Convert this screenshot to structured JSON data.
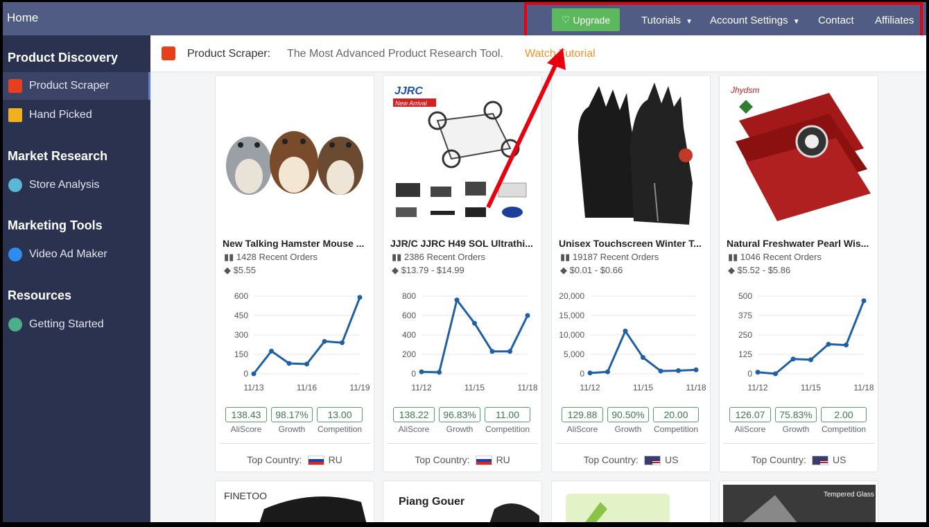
{
  "topbar": {
    "home": "Home",
    "upgrade": "Upgrade",
    "tutorials": "Tutorials",
    "account": "Account Settings",
    "contact": "Contact",
    "affiliates": "Affiliates"
  },
  "sidebar": {
    "sections": [
      {
        "title": "Product Discovery",
        "items": [
          {
            "label": "Product Scraper",
            "icon": "aliexpress-icon",
            "active": true
          },
          {
            "label": "Hand Picked",
            "icon": "gift-icon"
          }
        ]
      },
      {
        "title": "Market Research",
        "items": [
          {
            "label": "Store Analysis",
            "icon": "eye-icon"
          }
        ]
      },
      {
        "title": "Marketing Tools",
        "items": [
          {
            "label": "Video Ad Maker",
            "icon": "video-camera-icon"
          }
        ]
      },
      {
        "title": "Resources",
        "items": [
          {
            "label": "Getting Started",
            "icon": "rocket-icon"
          }
        ]
      }
    ]
  },
  "page_header": {
    "title": "Product Scraper:",
    "description": "The Most Advanced Product Research Tool.",
    "link": "Watch Tutorial"
  },
  "products": [
    {
      "name": "New Talking Hamster Mouse ...",
      "orders": "1428 Recent Orders",
      "price": "$5.55",
      "chart": {
        "x_labels": [
          "11/13",
          "11/16",
          "11/19"
        ],
        "y_ticks": [
          "600",
          "450",
          "300",
          "150",
          "0"
        ],
        "ymax": 600,
        "values": [
          0,
          175,
          80,
          75,
          250,
          240,
          590
        ]
      },
      "aliscore": "138.43",
      "growth": "98.17%",
      "competition": "13.00",
      "country_label": "Top Country:",
      "country": "RU"
    },
    {
      "name": "JJR/C JJRC H49 SOL Ultrathi...",
      "orders": "2386 Recent Orders",
      "price": "$13.79 - $14.99",
      "chart": {
        "x_labels": [
          "11/12",
          "11/15",
          "11/18"
        ],
        "y_ticks": [
          "800",
          "600",
          "400",
          "200",
          "0"
        ],
        "ymax": 800,
        "values": [
          20,
          15,
          760,
          520,
          230,
          230,
          600
        ]
      },
      "aliscore": "138.22",
      "growth": "96.83%",
      "competition": "11.00",
      "country_label": "Top Country:",
      "country": "RU"
    },
    {
      "name": "Unisex Touchscreen Winter T...",
      "orders": "19187 Recent Orders",
      "price": "$0.01 - $0.66",
      "chart": {
        "x_labels": [
          "11/12",
          "11/15",
          "11/18"
        ],
        "y_ticks": [
          "20,000",
          "15,000",
          "10,000",
          "5,000",
          "0"
        ],
        "ymax": 20000,
        "values": [
          200,
          500,
          11000,
          4200,
          700,
          800,
          1000
        ]
      },
      "aliscore": "129.88",
      "growth": "90.50%",
      "competition": "20.00",
      "country_label": "Top Country:",
      "country": "US"
    },
    {
      "name": "Natural Freshwater Pearl Wis...",
      "orders": "1046 Recent Orders",
      "price": "$5.52 - $5.86",
      "chart": {
        "x_labels": [
          "11/12",
          "11/15",
          "11/18"
        ],
        "y_ticks": [
          "500",
          "375",
          "250",
          "125",
          "0"
        ],
        "ymax": 500,
        "values": [
          10,
          0,
          95,
          90,
          190,
          185,
          470
        ]
      },
      "aliscore": "126.07",
      "growth": "75.83%",
      "competition": "2.00",
      "country_label": "Top Country:",
      "country": "US"
    }
  ],
  "metric_labels": {
    "aliscore": "AliScore",
    "growth": "Growth",
    "competition": "Competition"
  },
  "colors": {
    "topbar": "#515c85",
    "sidebar": "#2b3250",
    "upgrade": "#5cb85c",
    "highlight": "#e8000e",
    "link": "#f0932b",
    "line": "#1f5fa5"
  },
  "second_row_text": {
    "c1": "FINETOO",
    "c2": "Piang Gouer",
    "c4": "Tempered Glass"
  }
}
